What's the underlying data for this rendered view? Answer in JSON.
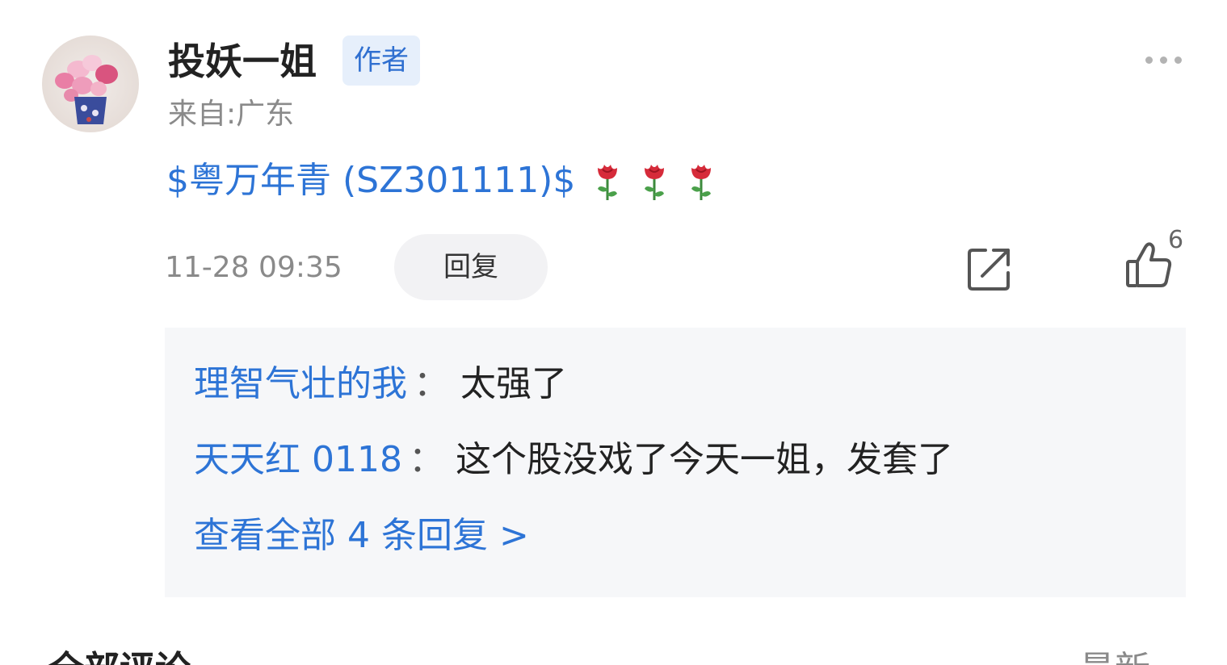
{
  "comment": {
    "author": {
      "name": "投妖一姐",
      "badge": "作者",
      "location": "来自:广东",
      "avatar_icon": "flower-bouquet-avatar"
    },
    "content": {
      "stock_link": "$粤万年青 (SZ301111)$",
      "emoji_icon": "rose-icon",
      "emoji_count": 3
    },
    "timestamp": "11-28 09:35",
    "reply_label": "回复",
    "share_icon": "share-icon",
    "like_icon": "thumbs-up-icon",
    "like_count": "6",
    "more_icon": "more-dots-icon"
  },
  "replies": {
    "separator": "：",
    "items": [
      {
        "author": "理智气壮的我",
        "text": "太强了"
      },
      {
        "author": "天天红 0118",
        "text": "这个股没戏了今天一姐，发套了"
      }
    ],
    "view_all": "查看全部 4 条回复 >"
  },
  "footer_partial": {
    "left": "全部评论",
    "right": "最新"
  },
  "colors": {
    "link_blue": "#2d74d6",
    "badge_bg": "#e6effb",
    "reply_box_bg": "#f6f7f9",
    "muted_text": "#8a8a8a"
  }
}
